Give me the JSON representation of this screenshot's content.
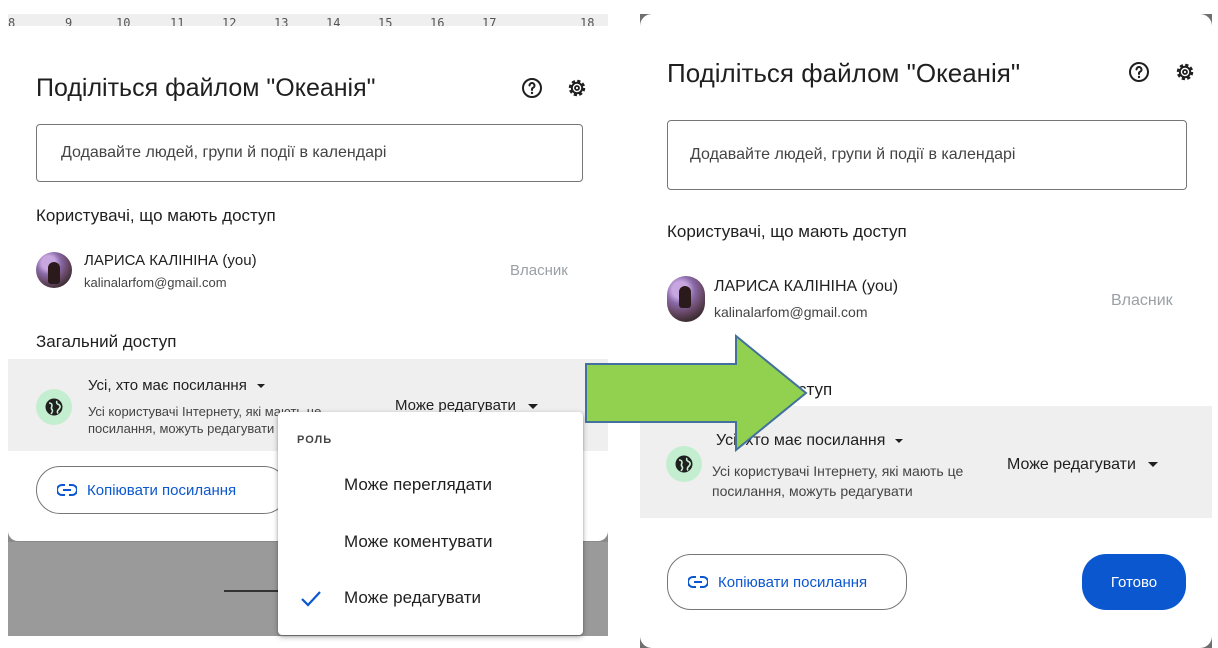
{
  "left": {
    "ruler_numbers": [
      "8",
      "9",
      "10",
      "11",
      "12",
      "13",
      "14",
      "15",
      "16",
      "17",
      "18"
    ],
    "dialog_title": "Поділіться файлом \"Океанія\"",
    "search_placeholder": "Додавайте людей, групи й події в календарі",
    "access_header": "Користувачі, що мають доступ",
    "user_name": "ЛАРИСА КАЛІНІНА (you)",
    "user_email": "kalinalarfom@gmail.com",
    "user_role": "Власник",
    "general_header": "Загальний доступ",
    "link_scope": "Усі, хто має посилання",
    "link_desc_line1": "Усі користувачі Інтернету, які мають це",
    "link_desc_line2": "посилання, можуть редагувати",
    "role_selected": "Може редагувати",
    "copy_link": "Копіювати посилання",
    "menu": {
      "header": "РОЛЬ",
      "items": [
        {
          "label": "Може переглядати",
          "checked": false
        },
        {
          "label": "Може коментувати",
          "checked": false
        },
        {
          "label": "Може редагувати",
          "checked": true
        }
      ]
    }
  },
  "right": {
    "dialog_title": "Поділіться файлом \"Океанія\"",
    "search_placeholder": "Додавайте людей, групи й події в календарі",
    "access_header": "Користувачі, що мають доступ",
    "user_name": "ЛАРИСА КАЛІНІНА (you)",
    "user_email": "kalinalarfom@gmail.com",
    "user_role": "Власник",
    "general_header_partial": "ступ",
    "link_scope": "Усі, хто має посилання",
    "link_desc_line1": "Усі користувачі Інтернету, які мають це",
    "link_desc_line2": "посилання, можуть редагувати",
    "role_selected": "Може редагувати",
    "copy_link": "Копіювати посилання",
    "done": "Готово"
  },
  "colors": {
    "accent_blue": "#0b57d0",
    "arrow_fill": "#92d050",
    "arrow_stroke": "#41719c",
    "globe_bg": "#c4eed0",
    "row_bg": "#efefef"
  },
  "icons": [
    "help-icon",
    "settings-icon",
    "globe-icon",
    "link-icon",
    "check-icon",
    "dropdown-caret-icon",
    "arrow-right-icon"
  ]
}
